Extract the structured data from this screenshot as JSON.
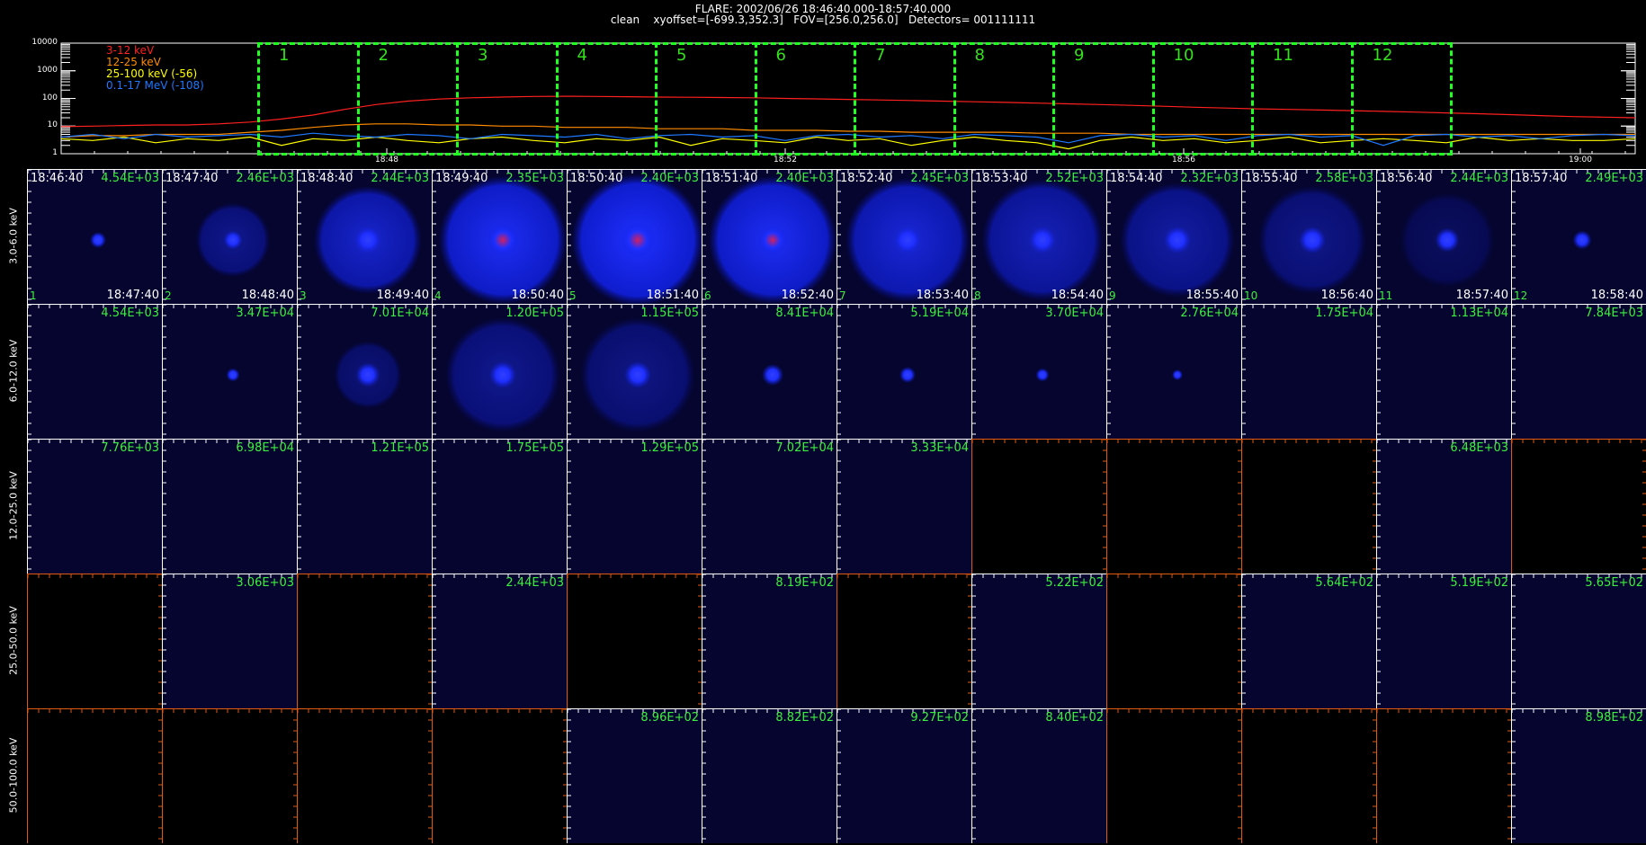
{
  "header": {
    "title": "FLARE: 2002/06/26 18:46:40.000-18:57:40.000",
    "subtitle": "clean    xyoffset=[-699.3,352.3]   FOV=[256.0,256.0]   Detectors= 001111111"
  },
  "colors": {
    "band_3_12": "#ff2020",
    "band_12_25": "#ff8c00",
    "band_25_100": "#ffff00",
    "band_01_17": "#1e78ff",
    "window_box": "#22ff22",
    "peak_text": "#3ef03e",
    "image_bg": "#050530",
    "axes_orange": "#e05a10"
  },
  "chart_data": [
    {
      "type": "line",
      "title": "",
      "ylabel": "",
      "yscale": "log",
      "ylim": [
        1,
        10000
      ],
      "y_ticks": [
        "10000",
        "1000",
        "100",
        "10",
        "1"
      ],
      "x_ticks": [
        "18:48",
        "18:52",
        "18:56",
        "19:00"
      ],
      "legend_placement": "top-left",
      "series": [
        {
          "name": "3-12 keV",
          "color": "#ff2020",
          "values": [
            9.5,
            10,
            10.5,
            11,
            11,
            12,
            14,
            18,
            25,
            40,
            60,
            80,
            95,
            105,
            112,
            118,
            120,
            118,
            115,
            112,
            110,
            108,
            105,
            100,
            96,
            92,
            88,
            84,
            80,
            76,
            72,
            68,
            64,
            60,
            56,
            52,
            48,
            45,
            42,
            40,
            38,
            36,
            34,
            32,
            30,
            28,
            26,
            24,
            22,
            21,
            20
          ]
        },
        {
          "name": "12-25 keV",
          "color": "#ff8c00",
          "values": [
            4,
            4.5,
            4.5,
            5,
            5,
            5,
            6,
            7,
            9,
            11,
            12,
            12,
            11,
            11,
            10,
            10,
            9,
            9,
            9,
            8,
            8,
            8,
            7,
            7,
            7,
            6.5,
            6.5,
            6,
            6,
            6,
            6,
            5.5,
            5.5,
            5.5,
            5,
            5,
            5,
            5,
            5,
            5,
            5,
            5,
            5,
            5,
            5,
            5,
            5,
            5,
            5,
            5,
            5
          ]
        },
        {
          "name": "25-100 keV (-56)",
          "color": "#ffff00",
          "values": [
            3.5,
            3,
            4,
            2.5,
            3.5,
            3,
            4,
            2,
            3.5,
            3,
            4,
            3,
            2.5,
            3.5,
            4,
            3,
            2.5,
            3.5,
            3,
            4,
            2,
            3.5,
            3,
            2.5,
            4,
            3,
            3.5,
            2,
            3,
            4,
            3,
            2.5,
            1.5,
            3,
            4,
            3,
            3.5,
            2.5,
            3,
            4,
            2.5,
            3,
            3.5,
            3,
            2.5,
            4,
            3,
            3.5,
            3,
            3,
            3.5
          ]
        },
        {
          "name": "0.1-17 MeV (-108)",
          "color": "#1e78ff",
          "values": [
            4,
            5,
            3.5,
            5,
            4,
            4.5,
            5,
            4,
            5.5,
            4.5,
            4,
            5,
            4.5,
            3.5,
            5,
            4.5,
            4,
            5,
            3.5,
            4.5,
            5,
            4,
            4.5,
            3,
            4.5,
            5,
            4,
            4.5,
            3.5,
            5,
            4.5,
            4,
            2.5,
            4.5,
            5,
            4,
            4.5,
            3,
            4.5,
            5,
            4,
            4.5,
            2,
            4.5,
            5,
            4,
            4.5,
            3.5,
            4.5,
            5,
            4.5
          ]
        }
      ],
      "windows": [
        "1",
        "2",
        "3",
        "4",
        "5",
        "6",
        "7",
        "8",
        "9",
        "10",
        "11",
        "12"
      ]
    },
    {
      "type": "heatmap",
      "rows": [
        "3.0-6.0 keV",
        "6.0-12.0 keV",
        "12.0-25.0 keV",
        "25.0-50.0 keV",
        "50.0-100.0 keV"
      ],
      "columns": 12,
      "start_times": [
        "18:46:40",
        "18:47:40",
        "18:48:40",
        "18:49:40",
        "18:50:40",
        "18:51:40",
        "18:52:40",
        "18:53:40",
        "18:54:40",
        "18:55:40",
        "18:56:40",
        "18:57:40"
      ],
      "end_times": [
        "18:47:40",
        "18:48:40",
        "18:49:40",
        "18:50:40",
        "18:51:40",
        "18:52:40",
        "18:53:40",
        "18:54:40",
        "18:55:40",
        "18:56:40",
        "18:57:40",
        "18:58:40"
      ],
      "cells": [
        [
          {
            "peak": "4.54E+03",
            "blank": false,
            "disk": 0.05,
            "core": 0.06,
            "bright": 0.4
          },
          {
            "peak": "2.46E+03",
            "blank": false,
            "disk": 0.55,
            "core": 0.07,
            "bright": 0.45
          },
          {
            "peak": "2.44E+03",
            "blank": false,
            "disk": 0.8,
            "core": 0.1,
            "bright": 0.75
          },
          {
            "peak": "2.35E+03",
            "blank": false,
            "disk": 0.95,
            "core": 0.12,
            "bright": 0.95
          },
          {
            "peak": "2.40E+03",
            "blank": false,
            "disk": 0.98,
            "core": 0.13,
            "bright": 1.0
          },
          {
            "peak": "2.40E+03",
            "blank": false,
            "disk": 0.95,
            "core": 0.11,
            "bright": 0.95
          },
          {
            "peak": "2.45E+03",
            "blank": false,
            "disk": 0.92,
            "core": 0.1,
            "bright": 0.8
          },
          {
            "peak": "2.52E+03",
            "blank": false,
            "disk": 0.9,
            "core": 0.1,
            "bright": 0.65
          },
          {
            "peak": "2.32E+03",
            "blank": false,
            "disk": 0.85,
            "core": 0.1,
            "bright": 0.55
          },
          {
            "peak": "2.58E+03",
            "blank": false,
            "disk": 0.8,
            "core": 0.1,
            "bright": 0.42
          },
          {
            "peak": "2.44E+03",
            "blank": false,
            "disk": 0.7,
            "core": 0.09,
            "bright": 0.22
          },
          {
            "peak": "2.49E+03",
            "blank": false,
            "disk": 0.0,
            "core": 0.07,
            "bright": 0.6
          }
        ],
        [
          {
            "peak": "4.54E+03",
            "blank": false,
            "disk": 0.0,
            "core": 0.0,
            "bright": 0.0
          },
          {
            "peak": "3.47E+04",
            "blank": false,
            "disk": 0.0,
            "core": 0.05,
            "bright": 0.4
          },
          {
            "peak": "7.01E+04",
            "blank": false,
            "disk": 0.5,
            "core": 0.09,
            "bright": 0.35
          },
          {
            "peak": "1.20E+05",
            "blank": false,
            "disk": 0.85,
            "core": 0.1,
            "bright": 0.45
          },
          {
            "peak": "1.15E+05",
            "blank": false,
            "disk": 0.85,
            "core": 0.1,
            "bright": 0.4
          },
          {
            "peak": "8.41E+04",
            "blank": false,
            "disk": 0.0,
            "core": 0.08,
            "bright": 0.6
          },
          {
            "peak": "5.19E+04",
            "blank": false,
            "disk": 0.0,
            "core": 0.06,
            "bright": 0.5
          },
          {
            "peak": "3.70E+04",
            "blank": false,
            "disk": 0.0,
            "core": 0.05,
            "bright": 0.4
          },
          {
            "peak": "2.76E+04",
            "blank": false,
            "disk": 0.0,
            "core": 0.04,
            "bright": 0.2
          },
          {
            "peak": "1.75E+04",
            "blank": false,
            "disk": 0.0,
            "core": 0.0,
            "bright": 0.0
          },
          {
            "peak": "1.13E+04",
            "blank": false,
            "disk": 0.0,
            "core": 0.0,
            "bright": 0.0
          },
          {
            "peak": "7.84E+03",
            "blank": false,
            "disk": 0.0,
            "core": 0.0,
            "bright": 0.0
          }
        ],
        [
          {
            "peak": "7.76E+03",
            "blank": false,
            "disk": 0,
            "core": 0,
            "bright": 0
          },
          {
            "peak": "6.98E+04",
            "blank": false,
            "disk": 0,
            "core": 0,
            "bright": 0
          },
          {
            "peak": "1.21E+05",
            "blank": false,
            "disk": 0,
            "core": 0,
            "bright": 0
          },
          {
            "peak": "1.75E+05",
            "blank": false,
            "disk": 0,
            "core": 0,
            "bright": 0
          },
          {
            "peak": "1.29E+05",
            "blank": false,
            "disk": 0,
            "core": 0,
            "bright": 0
          },
          {
            "peak": "7.02E+04",
            "blank": false,
            "disk": 0,
            "core": 0,
            "bright": 0
          },
          {
            "peak": "3.33E+04",
            "blank": false,
            "disk": 0,
            "core": 0,
            "bright": 0
          },
          {
            "peak": "",
            "blank": true
          },
          {
            "peak": "",
            "blank": true
          },
          {
            "peak": "",
            "blank": true
          },
          {
            "peak": "6.48E+03",
            "blank": false,
            "disk": 0,
            "core": 0,
            "bright": 0
          },
          {
            "peak": "",
            "blank": true
          }
        ],
        [
          {
            "peak": "",
            "blank": true
          },
          {
            "peak": "3.06E+03",
            "blank": false,
            "disk": 0,
            "core": 0,
            "bright": 0
          },
          {
            "peak": "",
            "blank": true
          },
          {
            "peak": "2.44E+03",
            "blank": false,
            "disk": 0,
            "core": 0,
            "bright": 0
          },
          {
            "peak": "",
            "blank": true
          },
          {
            "peak": "8.19E+02",
            "blank": false,
            "disk": 0,
            "core": 0,
            "bright": 0
          },
          {
            "peak": "",
            "blank": true
          },
          {
            "peak": "5.22E+02",
            "blank": false,
            "disk": 0,
            "core": 0,
            "bright": 0
          },
          {
            "peak": "",
            "blank": true
          },
          {
            "peak": "5.64E+02",
            "blank": false,
            "disk": 0,
            "core": 0,
            "bright": 0
          },
          {
            "peak": "5.19E+02",
            "blank": false,
            "disk": 0,
            "core": 0,
            "bright": 0
          },
          {
            "peak": "5.65E+02",
            "blank": false,
            "disk": 0,
            "core": 0,
            "bright": 0
          }
        ],
        [
          {
            "peak": "",
            "blank": true
          },
          {
            "peak": "",
            "blank": true
          },
          {
            "peak": "",
            "blank": true
          },
          {
            "peak": "",
            "blank": true
          },
          {
            "peak": "8.96E+02",
            "blank": false,
            "disk": 0,
            "core": 0,
            "bright": 0
          },
          {
            "peak": "8.82E+02",
            "blank": false,
            "disk": 0,
            "core": 0,
            "bright": 0
          },
          {
            "peak": "9.27E+02",
            "blank": false,
            "disk": 0,
            "core": 0,
            "bright": 0
          },
          {
            "peak": "8.40E+02",
            "blank": false,
            "disk": 0,
            "core": 0,
            "bright": 0
          },
          {
            "peak": "",
            "blank": true
          },
          {
            "peak": "",
            "blank": true
          },
          {
            "peak": "",
            "blank": true
          },
          {
            "peak": "8.98E+02",
            "blank": false,
            "disk": 0,
            "core": 0,
            "bright": 0
          }
        ]
      ]
    }
  ]
}
